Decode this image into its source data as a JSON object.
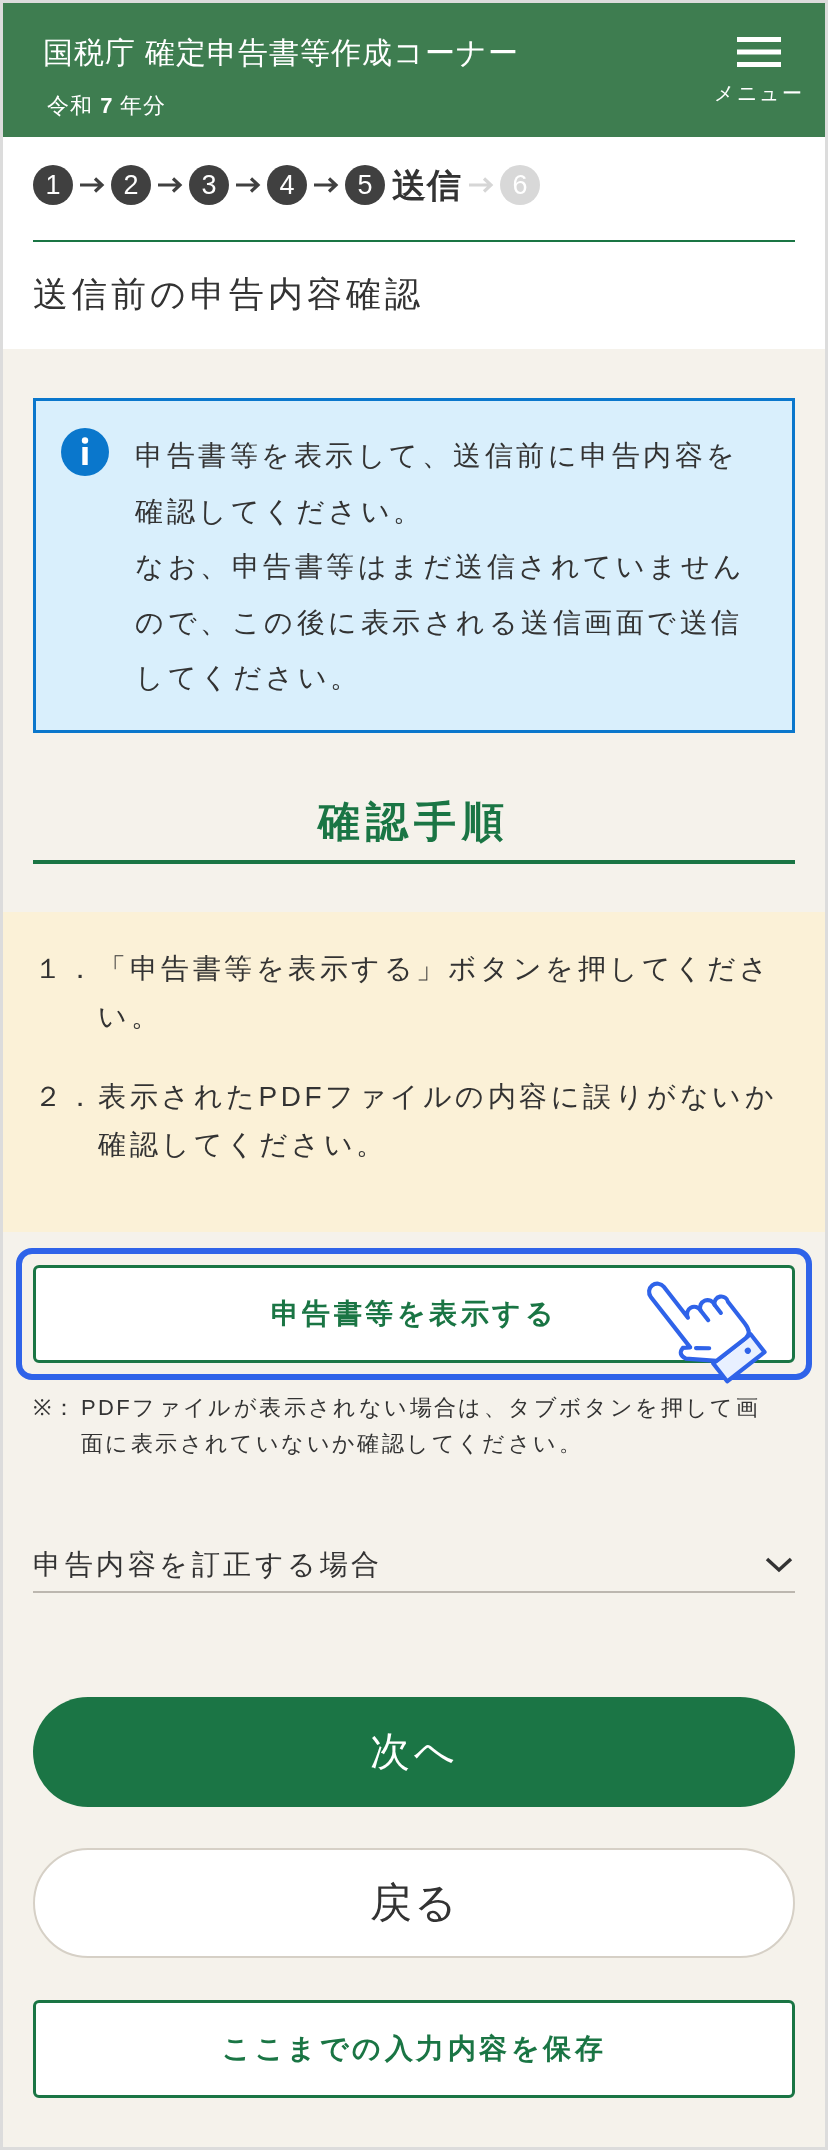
{
  "header": {
    "title": "国税庁 確定申告書等作成コーナー",
    "subtitle": "令和 **7** 年分",
    "menu_label": "メニュー"
  },
  "steps": [
    {
      "number": "1",
      "reached": true
    },
    {
      "number": "2",
      "reached": true
    },
    {
      "number": "3",
      "reached": true
    },
    {
      "number": "4",
      "reached": true
    },
    {
      "number": "5",
      "label": "送信",
      "reached": true
    },
    {
      "number": "6",
      "reached": false
    }
  ],
  "page_title": "送信前の申告内容確認",
  "info": {
    "paragraphs": [
      "申告書等を表示して、送信前に申告内容を確認してください。",
      "なお、申告書等はまだ送信されていませんので、この後に表示される送信画面で送信してください。"
    ]
  },
  "procedure": {
    "heading": "確認手順",
    "items": [
      {
        "marker": "１．",
        "text": "「申告書等を表示する」ボタンを押してください。"
      },
      {
        "marker": "２．",
        "text": "表示されたPDFファイルの内容に誤りがないか確認してください。"
      }
    ]
  },
  "show_button": {
    "label": "申告書等を表示する",
    "highlighted": true
  },
  "note": {
    "marker": "※：",
    "text": "PDFファイルが表示されない場合は、タブボタンを押して画面に表示されていないか確認してください。"
  },
  "correction": {
    "label": "申告内容を訂正する場合",
    "expanded": false
  },
  "buttons": [
    {
      "kind": "primary",
      "label": "次へ"
    },
    {
      "kind": "secondary",
      "label": "戻る"
    },
    {
      "kind": "outline",
      "label": "ここまでの入力内容を保存"
    }
  ]
}
